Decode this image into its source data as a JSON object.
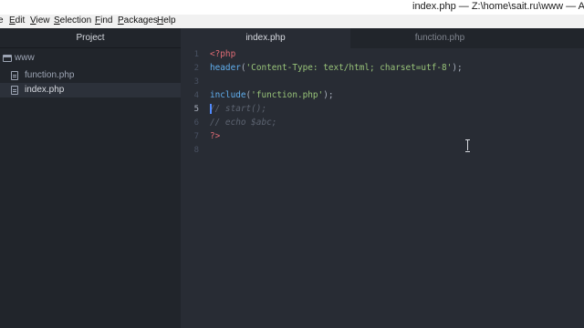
{
  "window": {
    "title": "index.php — Z:\\home\\sait.ru\\www — A"
  },
  "menubar": {
    "items": [
      {
        "label": "Edit",
        "ul": "E",
        "rest": "dit"
      },
      {
        "label": "View",
        "ul": "V",
        "rest": "iew"
      },
      {
        "label": "Selection",
        "ul": "S",
        "rest": "election"
      },
      {
        "label": "Find",
        "ul": "F",
        "rest": "ind"
      },
      {
        "label": "Packages",
        "ul": "P",
        "rest": "ackages"
      },
      {
        "label": "Help",
        "ul": "H",
        "rest": "elp"
      }
    ]
  },
  "sidebar": {
    "title": "Project",
    "tree": [
      {
        "label": "www",
        "icon": "folder-icon",
        "selected": false
      },
      {
        "label": "function.php",
        "icon": "file-icon",
        "selected": false
      },
      {
        "label": "index.php",
        "icon": "file-icon",
        "selected": true
      }
    ],
    "toggle_glyph": "‹"
  },
  "tabs": [
    {
      "label": "index.php",
      "active": true
    },
    {
      "label": "function.php",
      "active": false
    }
  ],
  "editor": {
    "current_line": 5,
    "line_numbers": [
      "1",
      "2",
      "3",
      "4",
      "5",
      "6",
      "7",
      "8"
    ],
    "lines": [
      [
        {
          "t": "<?php",
          "c": "tag"
        }
      ],
      [
        {
          "t": "header",
          "c": "fn"
        },
        {
          "t": "(",
          "c": "punc"
        },
        {
          "t": "'Content-Type: text/html; charset=utf-8'",
          "c": "str"
        },
        {
          "t": ");",
          "c": "punc"
        }
      ],
      [],
      [
        {
          "t": "include",
          "c": "fn"
        },
        {
          "t": "(",
          "c": "punc"
        },
        {
          "t": "'function.php'",
          "c": "str"
        },
        {
          "t": ");",
          "c": "punc"
        }
      ],
      [
        {
          "t": "// start();",
          "c": "comment"
        }
      ],
      [
        {
          "t": "// echo $abc;",
          "c": "comment"
        }
      ],
      [
        {
          "t": "?>",
          "c": "tag"
        }
      ],
      []
    ]
  },
  "colors": {
    "background": "#282c34",
    "sidebar": "#21252b",
    "cursor": "#528bff",
    "tag": "#e06c75",
    "function": "#61afef",
    "string": "#98c379",
    "comment": "#5c6370"
  }
}
